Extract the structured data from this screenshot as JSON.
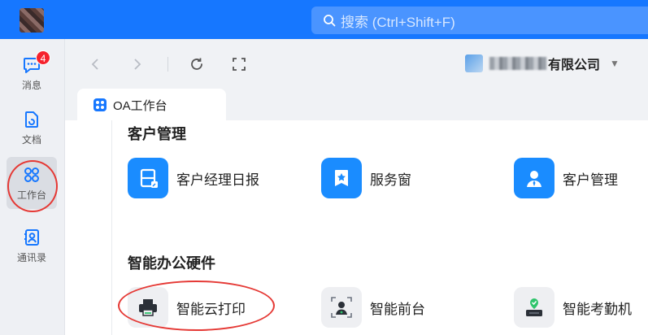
{
  "search": {
    "placeholder": "搜索 (Ctrl+Shift+F)"
  },
  "sidebar": {
    "items": [
      {
        "label": "消息",
        "icon": "message-icon",
        "badge": "4"
      },
      {
        "label": "文档",
        "icon": "document-icon"
      },
      {
        "label": "工作台",
        "icon": "workbench-icon",
        "active": true
      },
      {
        "label": "通讯录",
        "icon": "contacts-icon"
      }
    ]
  },
  "header": {
    "company_suffix": "有限公司"
  },
  "tab": {
    "label": "OA工作台"
  },
  "sections": [
    {
      "title": "客户管理",
      "apps": [
        {
          "label": "客户经理日报",
          "icon": "daily-report-icon"
        },
        {
          "label": "服务窗",
          "icon": "service-window-icon"
        },
        {
          "label": "客户管理",
          "icon": "customer-icon"
        }
      ]
    },
    {
      "title": "智能办公硬件",
      "apps": [
        {
          "label": "智能云打印",
          "icon": "printer-icon"
        },
        {
          "label": "智能前台",
          "icon": "reception-icon"
        },
        {
          "label": "智能考勤机",
          "icon": "attendance-machine-icon"
        }
      ]
    }
  ],
  "colors": {
    "accent": "#1677ff",
    "badge": "#f5222d",
    "annotation": "#e53935"
  }
}
